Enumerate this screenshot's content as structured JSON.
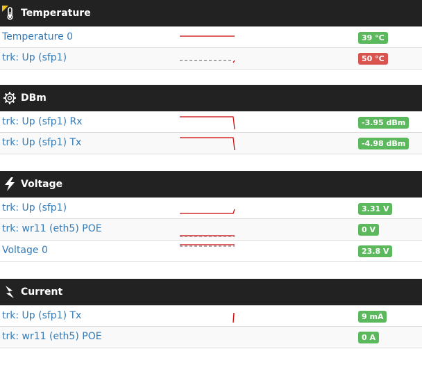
{
  "colors": {
    "header_bg": "#222222",
    "link": "#337ab7",
    "ok": "#5cb85c",
    "danger": "#d9534f",
    "spark": "#cc0000"
  },
  "sections": [
    {
      "title": "Temperature",
      "icon": "thermometer-icon",
      "rows": [
        {
          "name": "Temperature 0",
          "value": "39 °C",
          "status": "ok",
          "spark": "flat-line"
        },
        {
          "name": "trk: Up (sfp1)",
          "value": "50 °C",
          "status": "danger",
          "spark": "dashed-rise"
        }
      ]
    },
    {
      "title": "DBm",
      "icon": "gear-icon",
      "rows": [
        {
          "name": "trk: Up (sfp1) Rx",
          "value": "-3.95 dBm",
          "status": "ok",
          "spark": "flat-drop"
        },
        {
          "name": "trk: Up (sfp1) Tx",
          "value": "-4.98 dBm",
          "status": "ok",
          "spark": "flat-drop"
        }
      ]
    },
    {
      "title": "Voltage",
      "icon": "bolt-icon",
      "rows": [
        {
          "name": "trk: Up (sfp1)",
          "value": "3.31 V",
          "status": "ok",
          "spark": "flat-rise"
        },
        {
          "name": "trk: wr11 (eth5) POE",
          "value": "0 V",
          "status": "ok",
          "spark": "double-dashed"
        },
        {
          "name": "Voltage 0",
          "value": "23.8 V",
          "status": "ok",
          "spark": "flat-dashed-top"
        }
      ]
    },
    {
      "title": "Current",
      "icon": "plug-bolt-icon",
      "rows": [
        {
          "name": "trk: Up (sfp1) Tx",
          "value": "9 mA",
          "status": "ok",
          "spark": "spike"
        },
        {
          "name": "trk: wr11 (eth5) POE",
          "value": "0 A",
          "status": "ok",
          "spark": "none"
        }
      ]
    }
  ]
}
